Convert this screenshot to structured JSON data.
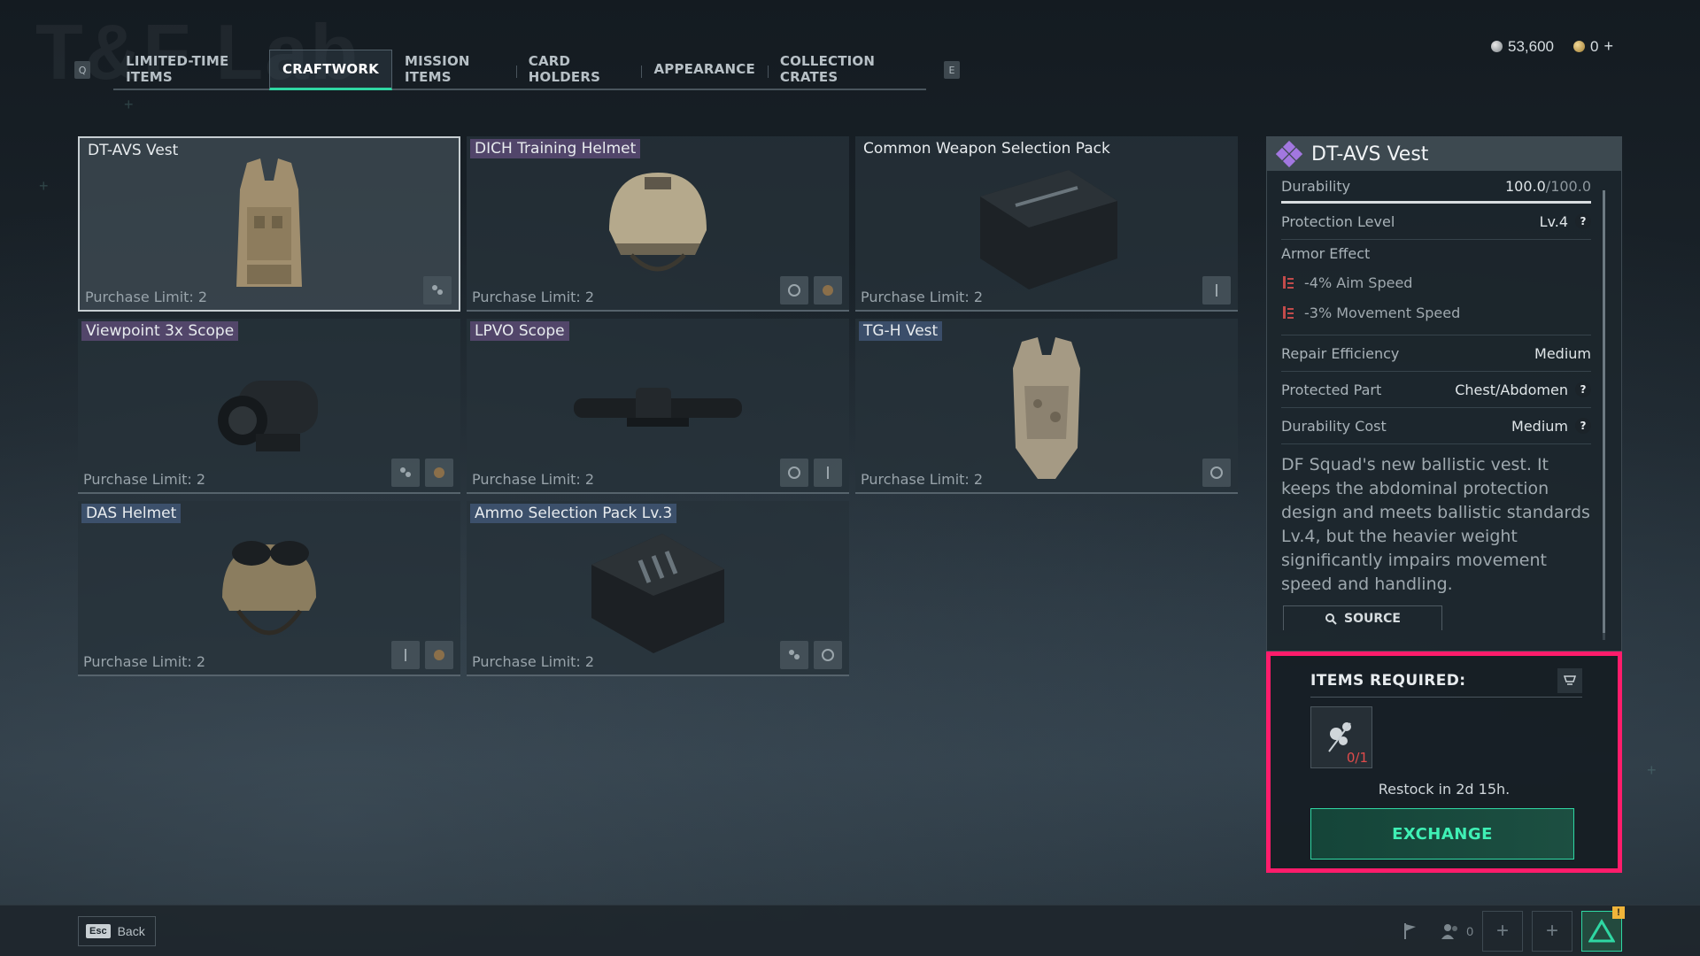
{
  "background_title": "T&F Lab",
  "tabs": {
    "prev_key": "Q",
    "next_key": "E",
    "items": [
      {
        "label": "LIMITED-TIME ITEMS"
      },
      {
        "label": "CRAFTWORK"
      },
      {
        "label": "MISSION ITEMS"
      },
      {
        "label": "CARD HOLDERS"
      },
      {
        "label": "APPEARANCE"
      },
      {
        "label": "COLLECTION CRATES"
      }
    ],
    "active_index": 1
  },
  "currency": {
    "silver": "53,600",
    "gold": "0",
    "add_label": "+"
  },
  "items": [
    {
      "name": "DT-AVS Vest",
      "limit": "Purchase Limit: 2",
      "tag_color": "none",
      "selected": true
    },
    {
      "name": "DICH Training Helmet",
      "limit": "Purchase Limit: 2",
      "tag_color": "purple"
    },
    {
      "name": "Common Weapon Selection Pack",
      "limit": "Purchase Limit: 2",
      "tag_color": "none"
    },
    {
      "name": "Viewpoint 3x Scope",
      "limit": "Purchase Limit: 2",
      "tag_color": "purple"
    },
    {
      "name": "LPVO Scope",
      "limit": "Purchase Limit: 2",
      "tag_color": "purple"
    },
    {
      "name": "TG-H Vest",
      "limit": "Purchase Limit: 2",
      "tag_color": "blue"
    },
    {
      "name": "DAS Helmet",
      "limit": "Purchase Limit: 2",
      "tag_color": "blue"
    },
    {
      "name": "Ammo Selection Pack Lv.3",
      "limit": "Purchase Limit: 2",
      "tag_color": "blue"
    }
  ],
  "detail": {
    "title": "DT-AVS Vest",
    "durability_label": "Durability",
    "durability_current": "100.0",
    "durability_max": "/100.0",
    "durability_fraction": 1.0,
    "protection_label": "Protection Level",
    "protection_value": "Lv.4",
    "armor_effect_label": "Armor Effect",
    "effects": [
      "-4% Aim Speed",
      "-3% Movement Speed"
    ],
    "repair_label": "Repair Efficiency",
    "repair_value": "Medium",
    "part_label": "Protected Part",
    "part_value": "Chest/Abdomen",
    "cost_label": "Durability Cost",
    "cost_value": "Medium",
    "description": "DF Squad's new ballistic vest. It keeps the abdominal protection design and meets ballistic standards Lv.4, but the heavier weight significantly impairs movement speed and handling.",
    "source_label": "SOURCE"
  },
  "required": {
    "title": "ITEMS REQUIRED:",
    "count": "0/1",
    "restock": "Restock in 2d 15h.",
    "exchange_label": "EXCHANGE"
  },
  "bottom": {
    "esc_key": "Esc",
    "back_label": "Back",
    "squad_count": "0"
  },
  "colors": {
    "accent": "#2fd7a3",
    "highlight_border": "#ff1c6b",
    "warning": "#f0b43a"
  }
}
